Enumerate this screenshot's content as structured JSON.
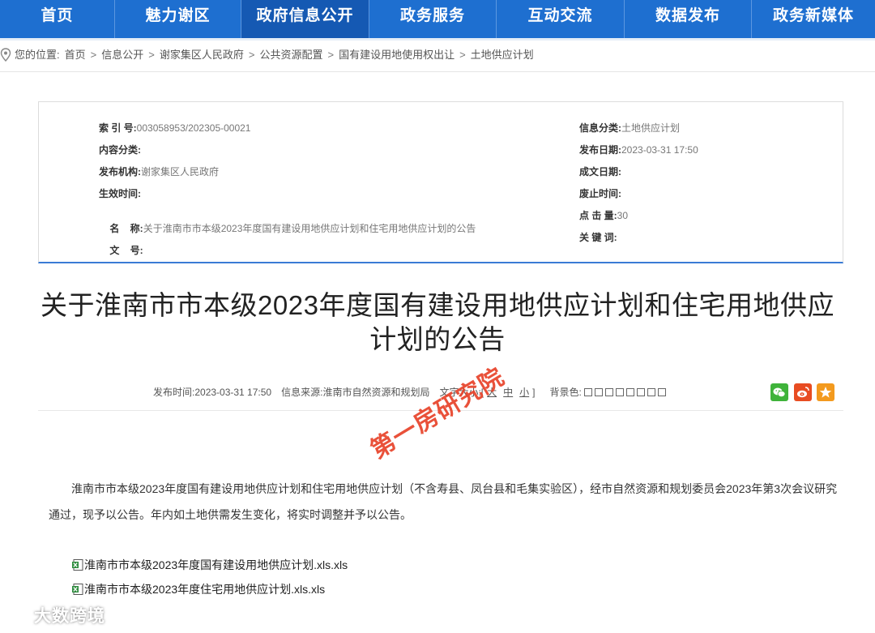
{
  "nav": {
    "items": [
      {
        "label": "首页",
        "active": false
      },
      {
        "label": "魅力谢区",
        "active": false
      },
      {
        "label": "政府信息公开",
        "active": true
      },
      {
        "label": "政务服务",
        "active": false
      },
      {
        "label": "互动交流",
        "active": false
      },
      {
        "label": "数据发布",
        "active": false
      },
      {
        "label": "政务新媒体",
        "active": false
      }
    ],
    "color": "#1e6fd0",
    "active_color": "#1559b3"
  },
  "breadcrumb": {
    "prefix": "您的位置:",
    "items": [
      "首页",
      "信息公开",
      "谢家集区人民政府",
      "公共资源配置",
      "国有建设用地使用权出让",
      "土地供应计划"
    ],
    "separator": ">"
  },
  "meta": {
    "index_label": "索 引 号:",
    "index_value": "003058953/202305-00021",
    "category_label": "信息分类:",
    "category_value": "土地供应计划",
    "content_cat_label": "内容分类:",
    "content_cat_value": "",
    "publish_date_label": "发布日期:",
    "publish_date_value": "2023-03-31 17:50",
    "org_label": "发布机构:",
    "org_value": "谢家集区人民政府",
    "doc_date_label": "成文日期:",
    "doc_date_value": "",
    "effective_label": "生效时间:",
    "effective_value": "",
    "abolish_label": "废止时间:",
    "abolish_value": "",
    "name_label": "名    称:",
    "name_value": "关于淮南市市本级2023年度国有建设用地供应计划和住宅用地供应计划的公告",
    "clicks_label": "点 击 量:",
    "clicks_value": "30",
    "docno_label": "文    号:",
    "docno_value": "",
    "keywords_label": "关 键 词:",
    "keywords_value": ""
  },
  "article": {
    "title": "关于淮南市市本级2023年度国有建设用地供应计划和住宅用地供应计划的公告",
    "publish_time_label": "发布时间:",
    "publish_time": "2023-03-31 17:50",
    "source_label": "信息来源:",
    "source": "淮南市自然资源和规划局",
    "font_size_label": "文字大小:[",
    "font_large": "大",
    "font_medium": "中",
    "font_small": "小",
    "font_close": "]",
    "bg_label": "背景色:",
    "body": "淮南市市本级2023年度国有建设用地供应计划和住宅用地供应计划（不含寿县、凤台县和毛集实验区），经市自然资源和规划委员会2023年第3次会议研究通过，现予以公告。年内如土地供需发生变化，将实时调整并予以公告。",
    "attachments": [
      "淮南市市本级2023年度国有建设用地供应计划.xls.xls",
      "淮南市市本级2023年度住宅用地供应计划.xls.xls"
    ]
  },
  "bg_swatches": [
    "#ffffff",
    "#ffffff",
    "#ffffff",
    "#ffffff",
    "#ffffff",
    "#ffffff",
    "#ffffff",
    "#ffffff"
  ],
  "share": {
    "wechat_color": "#3fb33a",
    "weibo_color": "#e84c22",
    "favorite_color": "#f39a1e"
  },
  "stamp": "第一房研究院",
  "watermark": "大数跨境"
}
